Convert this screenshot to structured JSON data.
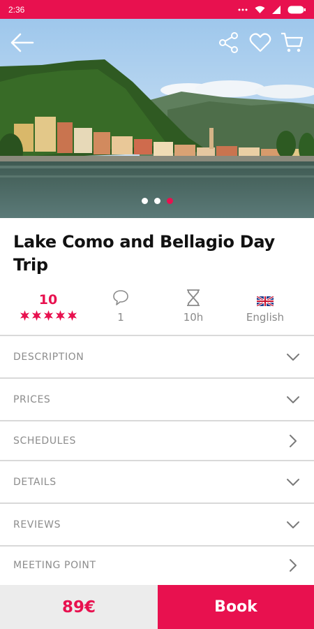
{
  "status_bar": {
    "time": "2:36",
    "icons": [
      "more-dots-icon",
      "wifi-icon",
      "signal-icon",
      "battery-icon"
    ]
  },
  "hero": {
    "icons": [
      "back-arrow-icon",
      "share-icon",
      "heart-icon",
      "cart-icon"
    ],
    "image_description_visible": false,
    "carousel": {
      "count": 3,
      "active_index": 2
    }
  },
  "tour": {
    "title": "Lake Como and Bellagio Day Trip"
  },
  "stats": {
    "rating": "10",
    "stars_filled": 5,
    "comments": "1",
    "duration": "10h",
    "language": "English"
  },
  "sections": [
    {
      "label": "DESCRIPTION",
      "chevron": "down"
    },
    {
      "label": "PRICES",
      "chevron": "down"
    },
    {
      "label": "SCHEDULES",
      "chevron": "right"
    },
    {
      "label": "DETAILS",
      "chevron": "down"
    },
    {
      "label": "REVIEWS",
      "chevron": "down"
    },
    {
      "label": "MEETING POINT",
      "chevron": "right"
    }
  ],
  "footer": {
    "price": "89€",
    "book_label": "Book"
  },
  "colors": {
    "accent": "#e8114f",
    "divider": "#d9d9d9",
    "muted_text": "#8c8c8c",
    "price_bg": "#ececec"
  }
}
